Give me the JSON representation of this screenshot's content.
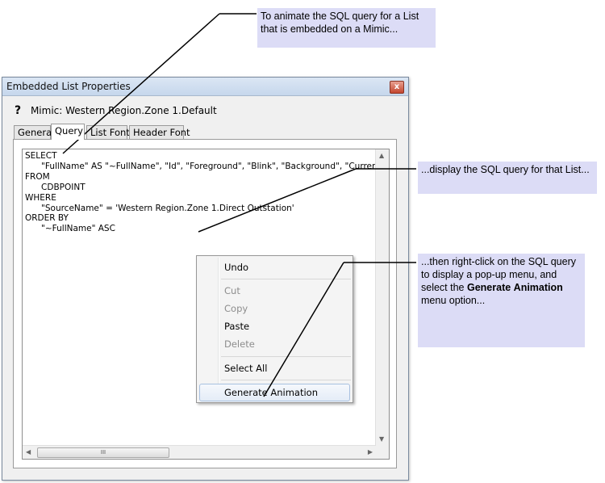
{
  "callouts": {
    "c1": "To animate the SQL query for a List that is embedded on a Mimic...",
    "c2": "...display the SQL query for that List...",
    "c3_pre": "...then right-click on the SQL query to display a pop-up menu, and select the ",
    "c3_bold1": "Generate",
    "c3_space": " ",
    "c3_bold2": "Animation",
    "c3_post": " menu option..."
  },
  "window": {
    "title": "Embedded List Properties",
    "close_glyph": "x",
    "help_glyph": "?",
    "mimic_label": "Mimic: Western Region.Zone 1.Default"
  },
  "tabs": [
    {
      "label": "General"
    },
    {
      "label": "Query"
    },
    {
      "label": "List Font"
    },
    {
      "label": "Header Font"
    }
  ],
  "editor": {
    "sql": "SELECT\n      \"FullName\" AS \"~FullName\", \"Id\", \"Foreground\", \"Blink\", \"Background\", \"CurrentValu\nFROM\n      CDBPOINT\nWHERE\n      \"SourceName\" = 'Western Region.Zone 1.Direct Outstation'\nORDER BY\n      \"~FullName\" ASC",
    "hscroll_grip": "III"
  },
  "context_menu": {
    "undo": "Undo",
    "cut": "Cut",
    "copy": "Copy",
    "paste": "Paste",
    "delete": "Delete",
    "select_all": "Select All",
    "generate_animation": "Generate Animation"
  },
  "colors": {
    "callout_bg": "#dcdcf6",
    "menu_highlight_border": "#a8c0e0"
  }
}
